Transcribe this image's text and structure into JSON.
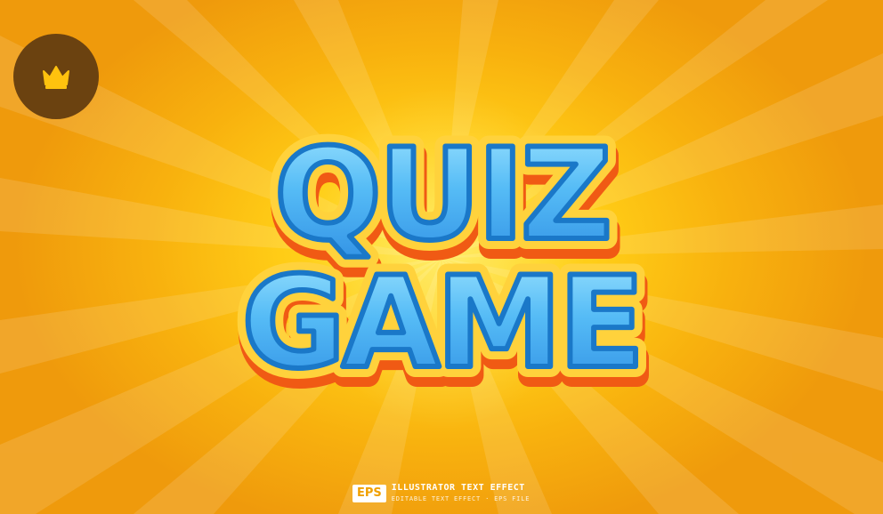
{
  "title": {
    "line1": "QUIZ",
    "line2": "GAME"
  },
  "badge": {
    "icon": "crown-icon"
  },
  "footer": {
    "format_tag": "EPS",
    "line1": "ILLUSTRATOR TEXT EFFECT",
    "line2": "EDITABLE TEXT EFFECT · EPS FILE"
  },
  "colors": {
    "background": "#ffc414",
    "text_fill": "#4bb2f2",
    "text_outline": "#1a78c8",
    "text_edge": "#ffd23c",
    "text_shadow": "#f05a14",
    "badge_bg": "#6b4210",
    "crown": "#ffc20e"
  }
}
